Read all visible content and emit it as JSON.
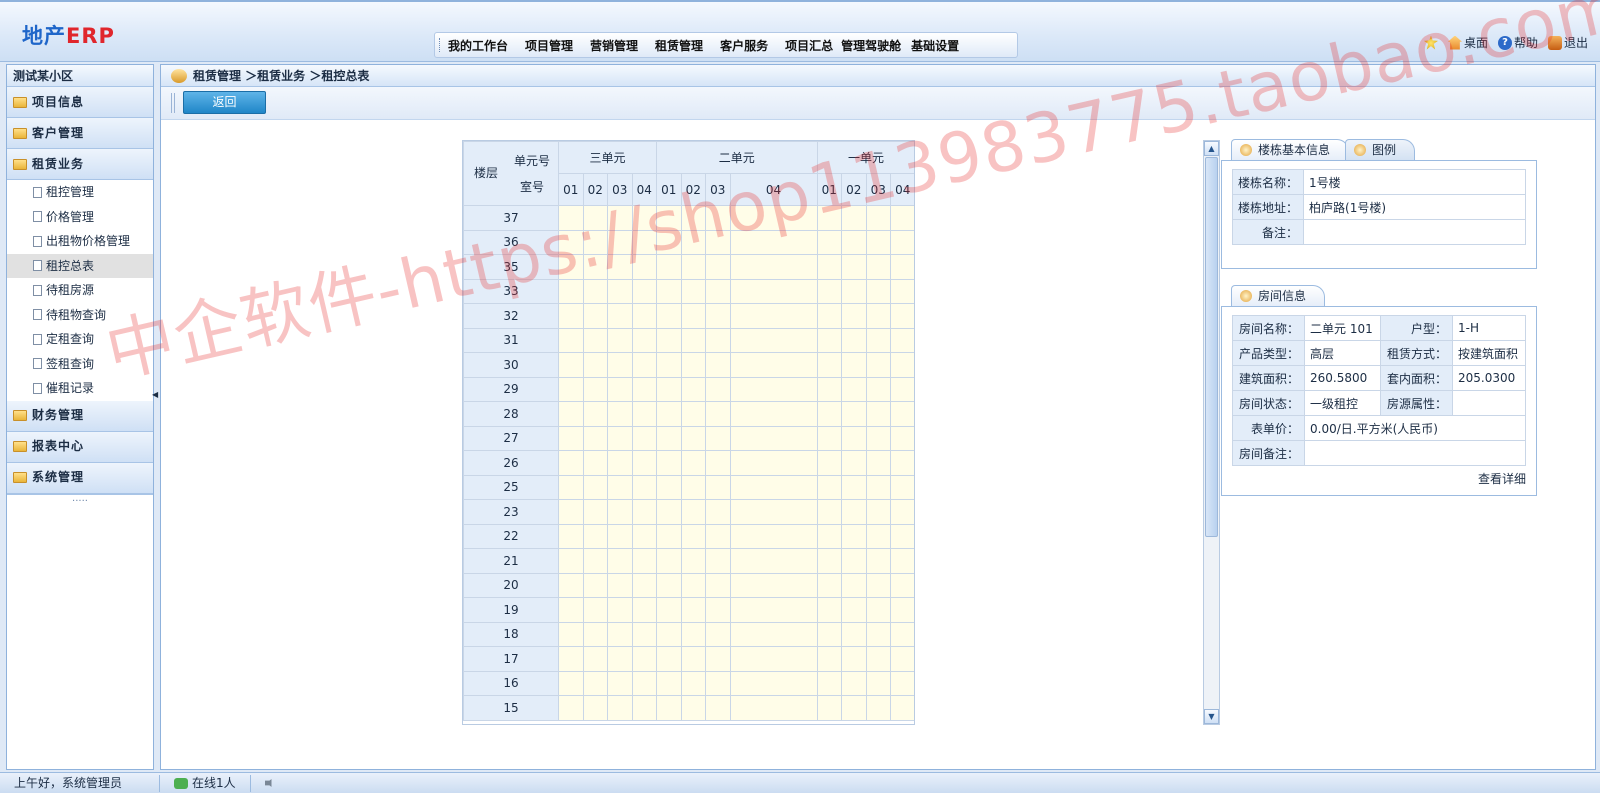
{
  "header": {
    "logo_cn": "地产",
    "logo_en": "ERP",
    "nav": [
      "我的工作台",
      "项目管理",
      "营销管理",
      "租赁管理",
      "客户服务",
      "项目汇总",
      "管理驾驶舱",
      "基础设置"
    ],
    "links": {
      "desk": "桌面",
      "help": "帮助",
      "exit": "退出"
    }
  },
  "sidebar": {
    "title": "测试某小区",
    "groups_top": [
      "项目信息",
      "客户管理",
      "租赁业务"
    ],
    "items": [
      "租控管理",
      "价格管理",
      "出租物价格管理",
      "租控总表",
      "待租房源",
      "待租物查询",
      "定租查询",
      "签租查询",
      "催租记录"
    ],
    "active_item": "租控总表",
    "groups_bottom": [
      "财务管理",
      "报表中心",
      "系统管理"
    ],
    "more": "....."
  },
  "breadcrumb": "租赁管理 ＞租赁业务 ＞租控总表",
  "toolbar": {
    "back_label": "返回"
  },
  "grid": {
    "corner_floor": "楼层",
    "corner_unit": "单元号",
    "corner_room": "室号",
    "units": [
      {
        "name": "三单元",
        "rooms": [
          "01",
          "02",
          "03",
          "04"
        ]
      },
      {
        "name": "二单元",
        "rooms": [
          "01",
          "02",
          "03",
          "04"
        ]
      },
      {
        "name": "一单元",
        "rooms": [
          "01",
          "02",
          "03",
          "04"
        ]
      }
    ],
    "floors": [
      "37",
      "36",
      "35",
      "33",
      "32",
      "31",
      "30",
      "29",
      "28",
      "27",
      "26",
      "25",
      "23",
      "22",
      "21",
      "20",
      "19",
      "18",
      "17",
      "16",
      "15"
    ]
  },
  "building_panel": {
    "tab_active": "楼栋基本信息",
    "tab_inactive": "图例",
    "rows": [
      {
        "label": "楼栋名称：",
        "value": "1号楼"
      },
      {
        "label": "楼栋地址：",
        "value": "柏庐路(1号楼)"
      },
      {
        "label": "备注：",
        "value": ""
      }
    ]
  },
  "room_panel": {
    "tab": "房间信息",
    "name_label": "房间名称：",
    "name_value": "二单元 101",
    "type_label": "户型：",
    "type_value": "1-H",
    "product_label": "产品类型：",
    "product_value": "高层",
    "lease_label": "租赁方式：",
    "lease_value": "按建筑面积",
    "area_label": "建筑面积：",
    "area_value": "260.5800",
    "inner_label": "套内面积：",
    "inner_value": "205.0300",
    "status_label": "房间状态：",
    "status_value": "一级租控",
    "attr_label": "房源属性：",
    "attr_value": "",
    "price_label": "表单价：",
    "price_value": "0.00/日.平方米(人民币)",
    "remark_label": "房间备注：",
    "remark_value": "",
    "detail_link": "查看详细"
  },
  "statusbar": {
    "greeting": "上午好，系统管理员",
    "online": "在线1人"
  },
  "watermark": "中企软件-https://shop113983775.taobao.com"
}
